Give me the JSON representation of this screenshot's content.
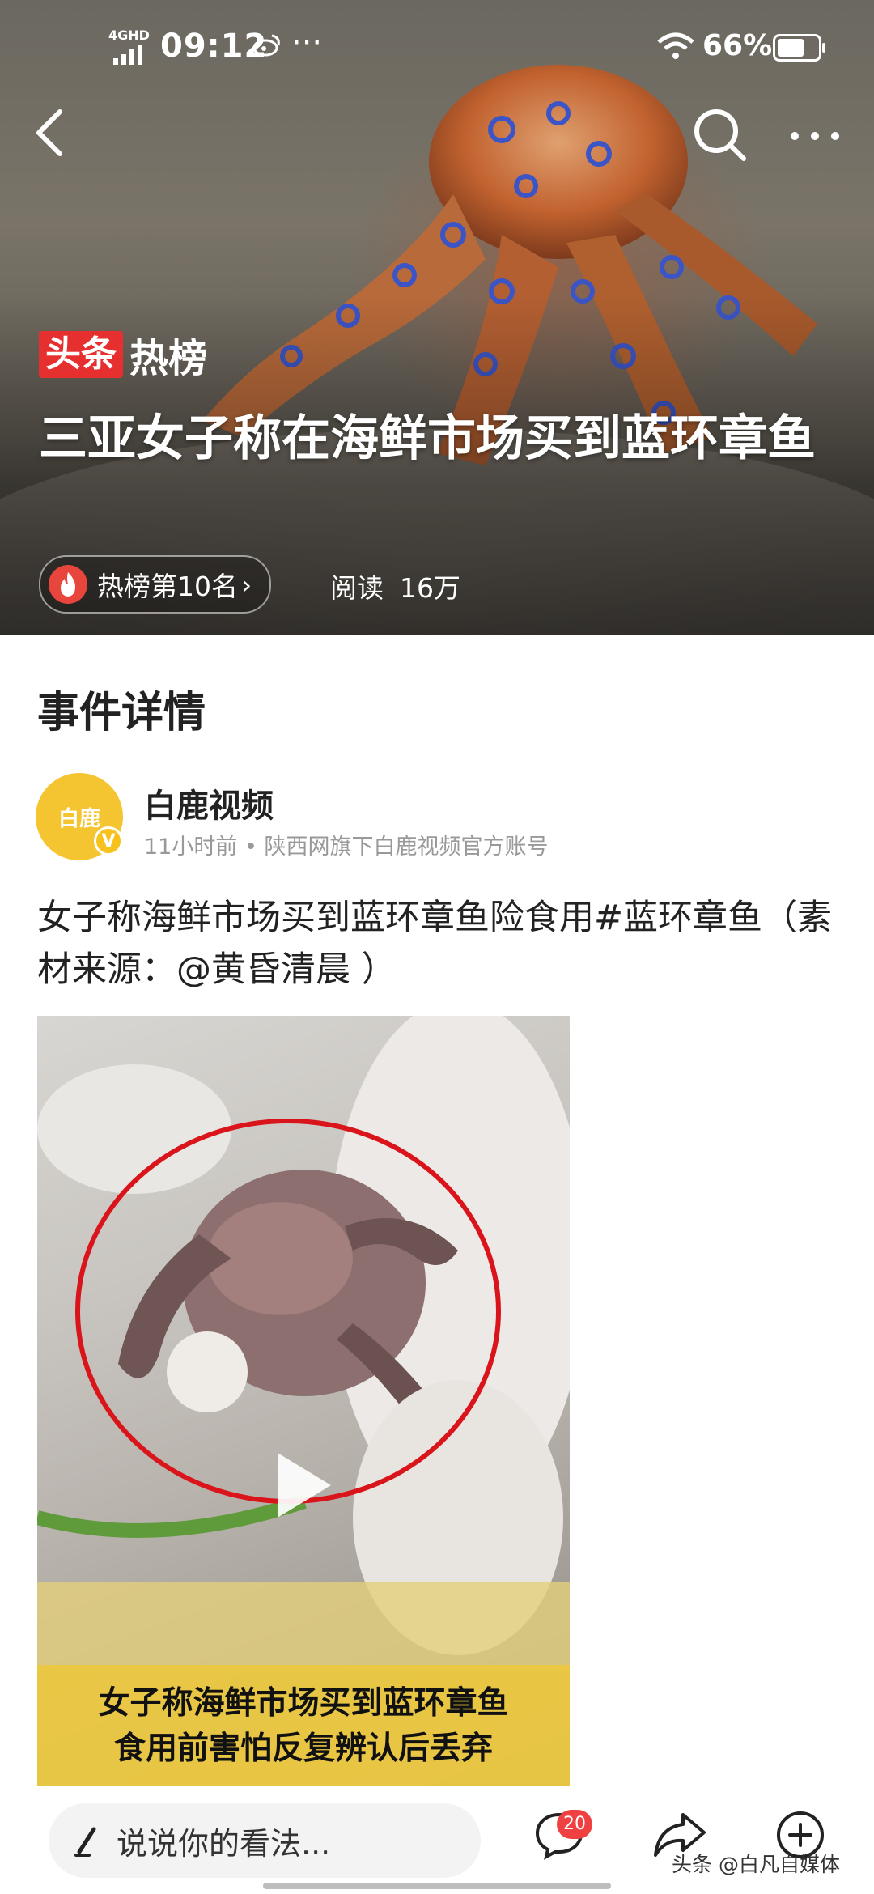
{
  "status_bar": {
    "network": "4GHD",
    "time": "09:12",
    "app_indicator": "weibo-icon",
    "more_indicator": "···",
    "battery_percent": "66%",
    "battery_level": 0.66
  },
  "nav": {
    "back_icon": "chevron-left-icon",
    "search_icon": "search-icon",
    "more_icon": "more-dots-icon",
    "more_text": "···"
  },
  "hero": {
    "brand_tag": "头条",
    "brand_word": "热榜",
    "title": "三亚女子称在海鲜市场买到蓝环章鱼",
    "rank_text": "热榜第10名",
    "rank_chevron": "›",
    "reads_label": "阅读",
    "reads_value": "16万"
  },
  "content": {
    "section_title": "事件详情",
    "author": {
      "avatar_text": "白鹿",
      "verified_mark": "V",
      "name": "白鹿视频",
      "meta": "11小时前 • 陕西网旗下白鹿视频官方账号"
    },
    "post_text": "女子称海鲜市场买到蓝环章鱼险食用#蓝环章鱼（素材来源：@黄昏清晨 ）",
    "video": {
      "caption_line1": "女子称海鲜市场买到蓝环章鱼",
      "caption_line2": "食用前害怕反复辨认后丢弃"
    }
  },
  "bottom_bar": {
    "comment_placeholder": "说说你的看法...",
    "comment_count": "20",
    "watermark": "头条 @白凡自媒体"
  },
  "colors": {
    "brand_red": "#e6302f",
    "badge_red": "#f04142",
    "avatar_yellow": "#f5c531",
    "caption_yellow": "#ecc840"
  }
}
